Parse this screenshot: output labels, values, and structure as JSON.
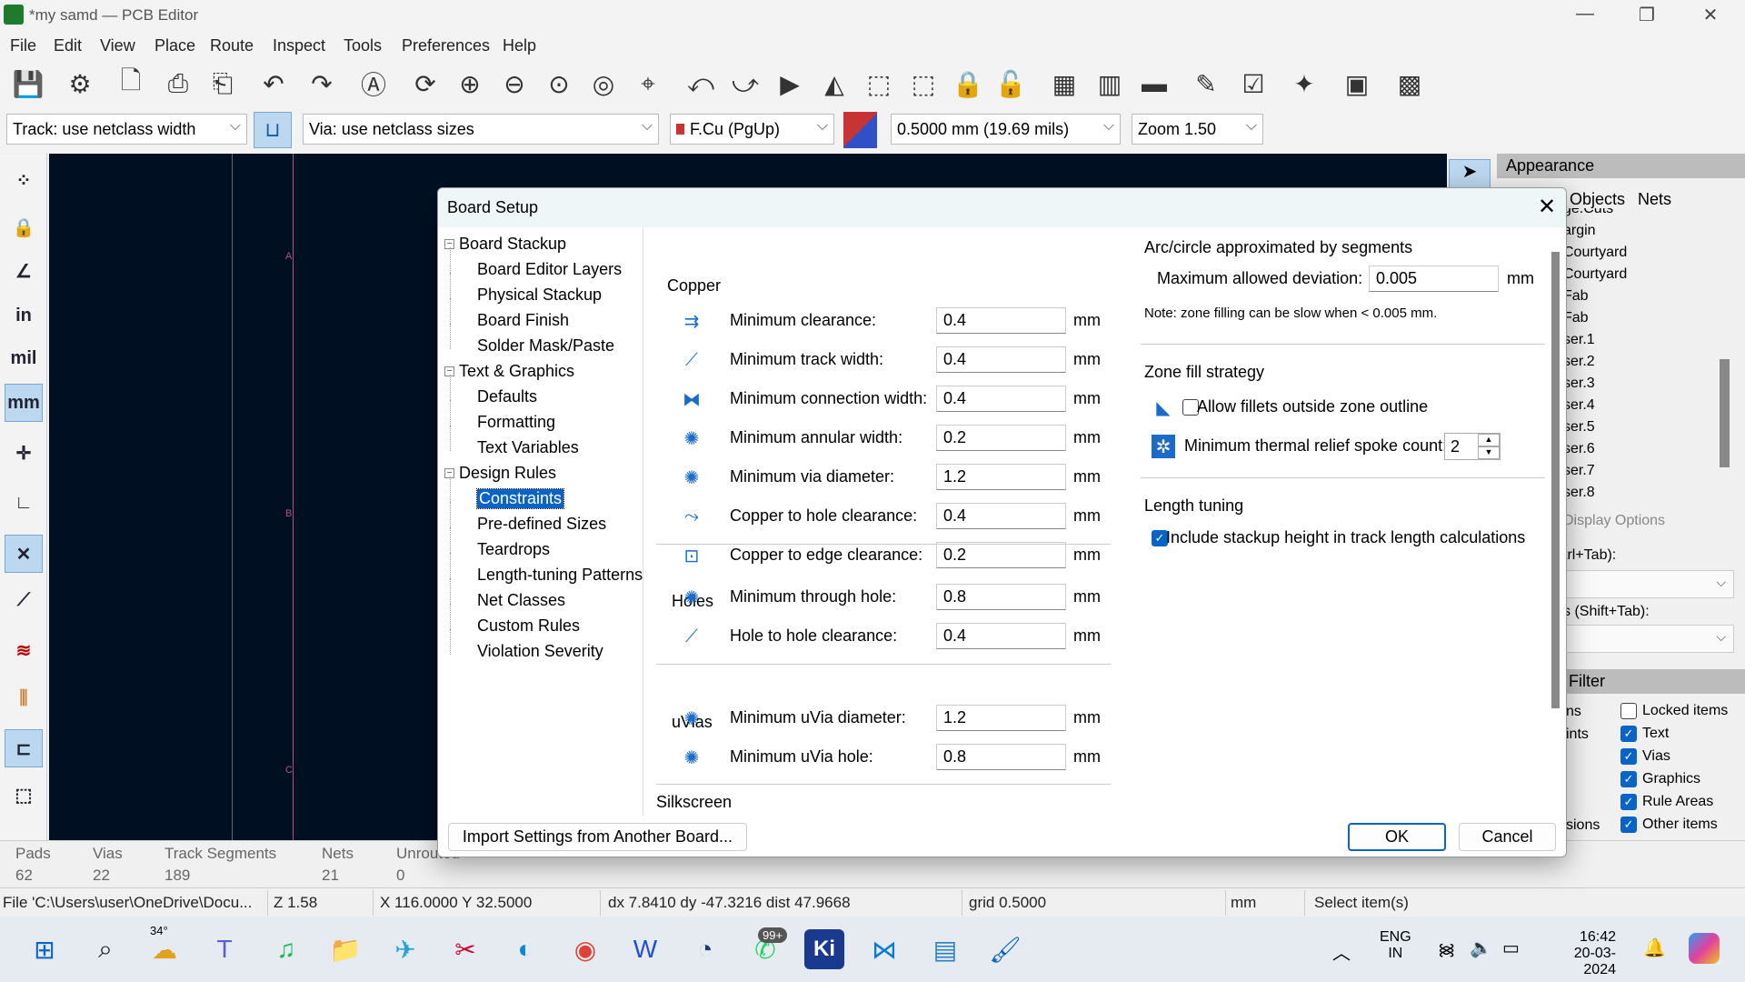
{
  "window": {
    "title": "*my samd — PCB Editor"
  },
  "menu": [
    "File",
    "Edit",
    "View",
    "Place",
    "Route",
    "Inspect",
    "Tools",
    "Preferences",
    "Help"
  ],
  "toolbar": {
    "icons": [
      "save-icon",
      "board-setup-icon",
      "page-settings-icon",
      "print-icon",
      "plot-icon",
      "undo-icon",
      "redo-icon",
      "find-icon",
      "refresh-icon",
      "zoom-in-icon",
      "zoom-out-icon",
      "zoom-fit-icon",
      "zoom-objects-icon",
      "zoom-selection-icon",
      "rotate-ccw-icon",
      "rotate-cw-icon",
      "flip-icon",
      "mirror-icon",
      "group-icon",
      "ungroup-icon",
      "lock-icon",
      "unlock-icon",
      "netlist-icon",
      "footprint-library-icon",
      "footprint-editor-icon",
      "drc-icon",
      "checklist-icon",
      "net-inspector-icon",
      "scripting-console-icon",
      "plugin-icon"
    ]
  },
  "toolbar2": {
    "track": "Track: use netclass width",
    "via": "Via: use netclass sizes",
    "layer": "F.Cu (PgUp)",
    "grid": "0.5000 mm (19.69 mils)",
    "zoom": "Zoom 1.50",
    "layer_color": "#c83434"
  },
  "leftbar": {
    "labels": {
      "in": "in",
      "mil": "mil",
      "mm": "mm"
    }
  },
  "canvas": {
    "sheet_labels": [
      "A",
      "B",
      "C"
    ],
    "background": "#001023"
  },
  "appearance": {
    "title": "Appearance",
    "tabs": [
      "Objects",
      "Nets"
    ],
    "layers": [
      "ge.Cuts",
      "argin",
      "Courtyard",
      "Courtyard",
      "Fab",
      "Fab",
      "ser.1",
      "ser.2",
      "ser.3",
      "ser.4",
      "ser.5",
      "ser.6",
      "ser.7",
      "ser.8"
    ],
    "display_options": "Display Options",
    "preset_label": "trl+Tab):",
    "viewport_label": "s (Shift+Tab):",
    "filter_title": "Filter",
    "filter_left": [
      "ns",
      "ints",
      "",
      "",
      "",
      "sions"
    ],
    "filter_items": [
      {
        "label": "Locked items",
        "checked": false
      },
      {
        "label": "Text",
        "checked": true
      },
      {
        "label": "Vias",
        "checked": true
      },
      {
        "label": "Graphics",
        "checked": true
      },
      {
        "label": "Rule Areas",
        "checked": true
      },
      {
        "label": "Other items",
        "checked": true
      }
    ]
  },
  "messages": {
    "headers": [
      "Pads",
      "Vias",
      "Track Segments",
      "Nets",
      "Unrouted"
    ],
    "values": [
      "62",
      "22",
      "189",
      "21",
      "0"
    ]
  },
  "status": {
    "file": "File 'C:\\Users\\user\\OneDrive\\Docu...",
    "z": "Z 1.58",
    "xy": "X 116.0000  Y 32.5000",
    "delta": "dx 7.8410  dy -47.3216  dist 47.9668",
    "grid": "grid 0.5000",
    "units": "mm",
    "mode": "Select item(s)"
  },
  "dialog": {
    "title": "Board Setup",
    "tree": [
      {
        "label": "Board Stackup",
        "level": 0
      },
      {
        "label": "Board Editor Layers",
        "level": 1
      },
      {
        "label": "Physical Stackup",
        "level": 1
      },
      {
        "label": "Board Finish",
        "level": 1
      },
      {
        "label": "Solder Mask/Paste",
        "level": 1
      },
      {
        "label": "Text & Graphics",
        "level": 0
      },
      {
        "label": "Defaults",
        "level": 1
      },
      {
        "label": "Formatting",
        "level": 1
      },
      {
        "label": "Text Variables",
        "level": 1
      },
      {
        "label": "Design Rules",
        "level": 0
      },
      {
        "label": "Constraints",
        "level": 1,
        "selected": true
      },
      {
        "label": "Pre-defined Sizes",
        "level": 1
      },
      {
        "label": "Teardrops",
        "level": 1
      },
      {
        "label": "Length-tuning Patterns",
        "level": 1
      },
      {
        "label": "Net Classes",
        "level": 1
      },
      {
        "label": "Custom Rules",
        "level": 1
      },
      {
        "label": "Violation Severity",
        "level": 1
      }
    ],
    "copper": {
      "title": "Copper",
      "rows": [
        {
          "label": "Minimum clearance:",
          "value": "0.4",
          "unit": "mm",
          "icon": "clearance-icon"
        },
        {
          "label": "Minimum track width:",
          "value": "0.4",
          "unit": "mm",
          "icon": "track-width-icon"
        },
        {
          "label": "Minimum connection width:",
          "value": "0.4",
          "unit": "mm",
          "icon": "connection-width-icon"
        },
        {
          "label": "Minimum annular width:",
          "value": "0.2",
          "unit": "mm",
          "icon": "annular-width-icon"
        },
        {
          "label": "Minimum via diameter:",
          "value": "1.2",
          "unit": "mm",
          "icon": "via-diameter-icon"
        },
        {
          "label": "Copper to hole clearance:",
          "value": "0.4",
          "unit": "mm",
          "icon": "hole-clearance-icon"
        },
        {
          "label": "Copper to edge clearance:",
          "value": "0.2",
          "unit": "mm",
          "icon": "edge-clearance-icon"
        }
      ]
    },
    "holes": {
      "title": "Holes",
      "rows": [
        {
          "label": "Minimum through hole:",
          "value": "0.8",
          "unit": "mm",
          "icon": "through-hole-icon"
        },
        {
          "label": "Hole to hole clearance:",
          "value": "0.4",
          "unit": "mm",
          "icon": "hole-to-hole-icon"
        }
      ]
    },
    "uvias": {
      "title": "uVias",
      "rows": [
        {
          "label": "Minimum uVia diameter:",
          "value": "1.2",
          "unit": "mm",
          "icon": "uvia-diameter-icon"
        },
        {
          "label": "Minimum uVia hole:",
          "value": "0.8",
          "unit": "mm",
          "icon": "uvia-hole-icon"
        }
      ]
    },
    "silkscreen": {
      "title": "Silkscreen"
    },
    "arc": {
      "title": "Arc/circle approximated by segments",
      "label": "Maximum allowed deviation:",
      "value": "0.005",
      "unit": "mm",
      "note": "Note: zone filling can be slow when < 0.005 mm."
    },
    "zone": {
      "title": "Zone fill strategy",
      "fillets_label": "Allow fillets outside zone outline",
      "fillets_checked": false,
      "spoke_label": "Minimum thermal relief spoke count:",
      "spoke_value": "2"
    },
    "length": {
      "title": "Length tuning",
      "stackup_label": "Include stackup height in track length calculations",
      "stackup_checked": true
    },
    "import_button": "Import Settings from Another Board...",
    "ok": "OK",
    "cancel": "Cancel"
  },
  "taskbar": {
    "icons": [
      "start-icon",
      "search-icon",
      "weather-icon",
      "teams-icon",
      "spotify-icon",
      "file-explorer-icon",
      "telegram-icon",
      "snipping-tool-icon",
      "edge-icon",
      "chrome-icon",
      "app-icon",
      "clock-app-icon",
      "whatsapp-icon",
      "kicad-icon",
      "vscode-icon",
      "notepad-icon",
      "paint-icon"
    ],
    "weather": "34°",
    "badge": "99+",
    "kicad_label": "Ki",
    "lang1": "ENG",
    "lang2": "IN",
    "time": "16:42",
    "date": "20-03-2024"
  }
}
